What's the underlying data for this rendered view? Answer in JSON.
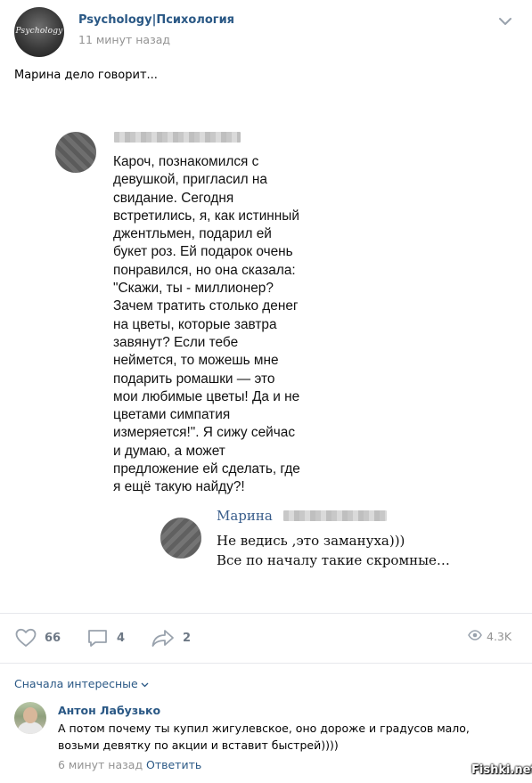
{
  "header": {
    "author": "Psychology|Психология",
    "time": "11 минут назад",
    "avatar_caption": "Psychology"
  },
  "post": {
    "text": "Марина дело говорит..."
  },
  "picture": {
    "message_lines": [
      "Кароч, познакомился с",
      "девушкой, пригласил на",
      "свидание. Сегодня",
      "встретились, я, как истинный",
      "джентльмен, подарил ей",
      "букет роз. Ей подарок очень",
      "понравился, но она сказала:",
      "\"Скажи, ты - миллионер?",
      "Зачем тратить столько денег",
      "на цветы, которые завтра",
      "завянут? Если тебе",
      "неймется, то можешь мне",
      "подарить ромашки — это",
      "мои любимые цветы! Да и не",
      "цветами симпатия",
      "измеряется!\". Я сижу сейчас",
      "и думаю, а может",
      "предложение ей сделать, где",
      "я ещё такую найду?!"
    ],
    "reply_name": "Марина",
    "reply_lines": [
      "Не ведись ,это замануха)))",
      "Все по началу такие скромные…"
    ]
  },
  "actions": {
    "likes": "66",
    "comments": "4",
    "shares": "2",
    "views": "4.3K"
  },
  "comments_section": {
    "sort_label": "Сначала интересные",
    "comment": {
      "author": "Антон Лабузько",
      "lines": [
        "А потом почему ты купил жигулевское, оно дороже и градусов мало,",
        "возьми девятку по акции и вставит быстрей))))"
      ],
      "time": "6 минут назад",
      "reply_label": "Ответить"
    }
  },
  "watermark": "Fishki.net",
  "colors": {
    "link": "#2a5885",
    "muted": "#939393",
    "icon": "#99a2ad",
    "separator": "#e7e8ec"
  },
  "icons": [
    "chevron-down-icon",
    "like-icon",
    "comment-icon",
    "share-icon",
    "views-icon"
  ]
}
